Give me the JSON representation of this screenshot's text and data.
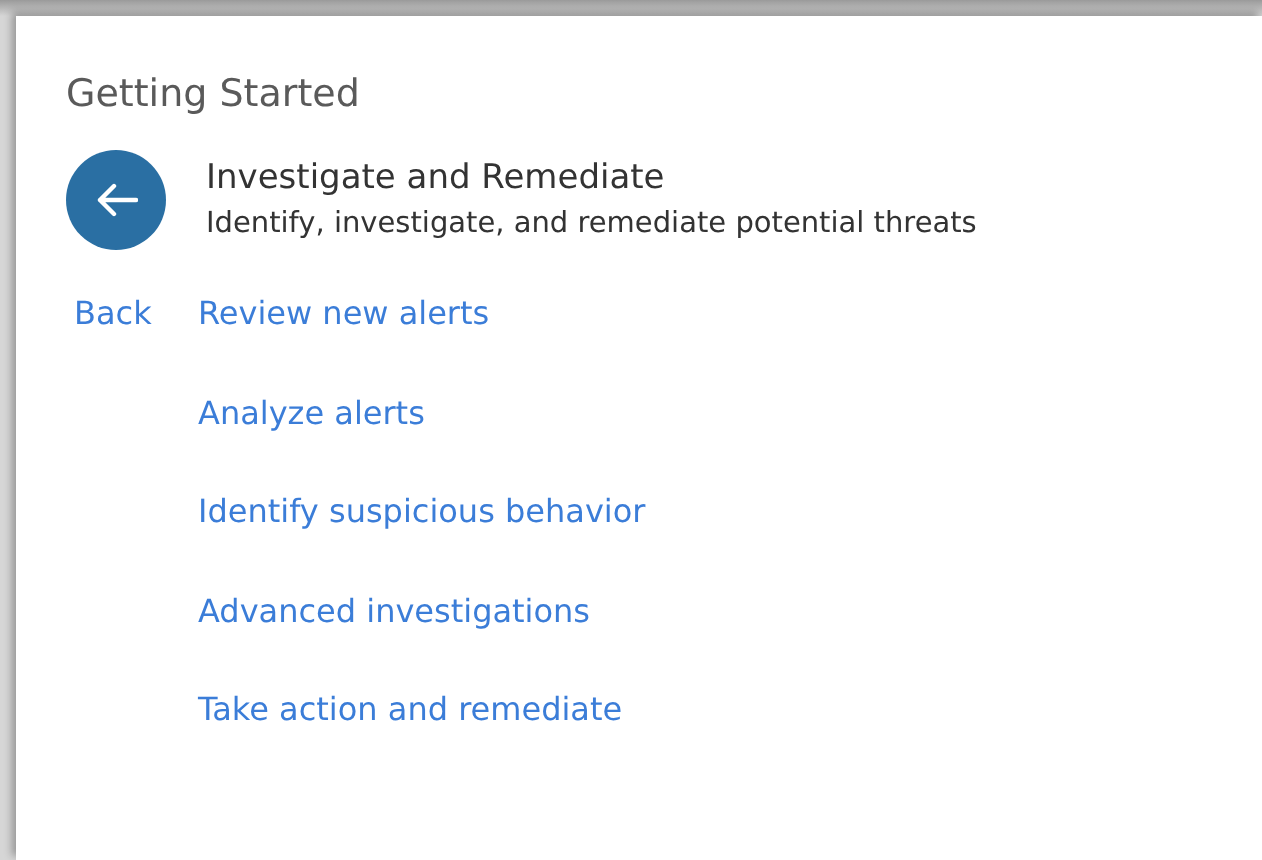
{
  "heading": "Getting Started",
  "section": {
    "title": "Investigate and Remediate",
    "subtitle": "Identify, investigate, and remediate potential threats"
  },
  "back_link": "Back",
  "links": [
    "Review new alerts",
    "Analyze alerts",
    "Identify suspicious behavior",
    "Advanced investigations",
    "Take action and remediate"
  ]
}
